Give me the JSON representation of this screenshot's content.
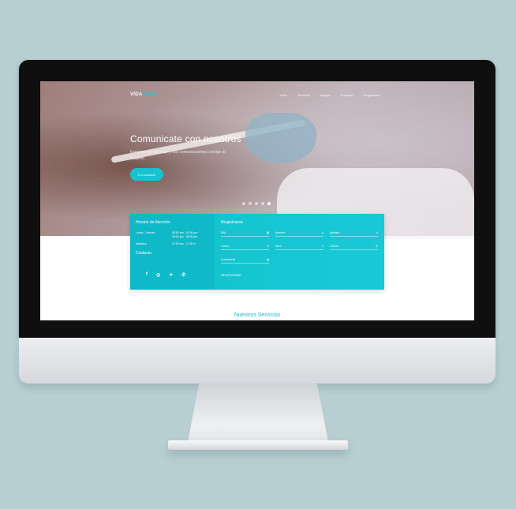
{
  "site": {
    "brand_prefix": "VIDA",
    "brand_suffix": "SANA",
    "menu": [
      "Inicio",
      "Servicios",
      "Equipo",
      "Contacto",
      "Registrarse"
    ]
  },
  "hero": {
    "title": "Comunicate con nosotros",
    "text": "Envianos un mensaje y nos comunicaremos contigo al instante.",
    "button": "Ir a contacto",
    "slides": 5,
    "active_slide": 5
  },
  "hours": {
    "title": "Horario de Atención",
    "rows": [
      {
        "day": "Lunes - Viernes",
        "times": [
          "08:00 am - 01:00 pm",
          "03:00 pm - 08:00 pm"
        ]
      },
      {
        "day": "Sábados",
        "times": [
          "07:00 am - 12:30 m"
        ]
      }
    ],
    "contact_title": "Contacto",
    "social_icons": [
      "facebook-icon",
      "instagram-icon",
      "twitter-icon",
      "whatsapp-icon"
    ]
  },
  "register": {
    "title": "Registrarse",
    "fields": [
      {
        "label": "DNI",
        "icon": "id-icon"
      },
      {
        "label": "Nombre",
        "icon": "user-icon"
      },
      {
        "label": "Apellido",
        "icon": "user-icon"
      },
      {
        "label": "Correo",
        "icon": "send-icon"
      },
      {
        "label": "Sexo",
        "icon": "chevron-down-icon"
      },
      {
        "label": "Celular",
        "icon": "phone-icon"
      },
      {
        "label": "Contraseña",
        "icon": "lock-icon"
      }
    ],
    "submit": "REGISTRARME"
  },
  "section": {
    "title": "Nuestros Servicios"
  },
  "colors": {
    "accent": "#17c3d0",
    "hours_bg": "#0fb9c8",
    "background": "#b7cfd3"
  }
}
